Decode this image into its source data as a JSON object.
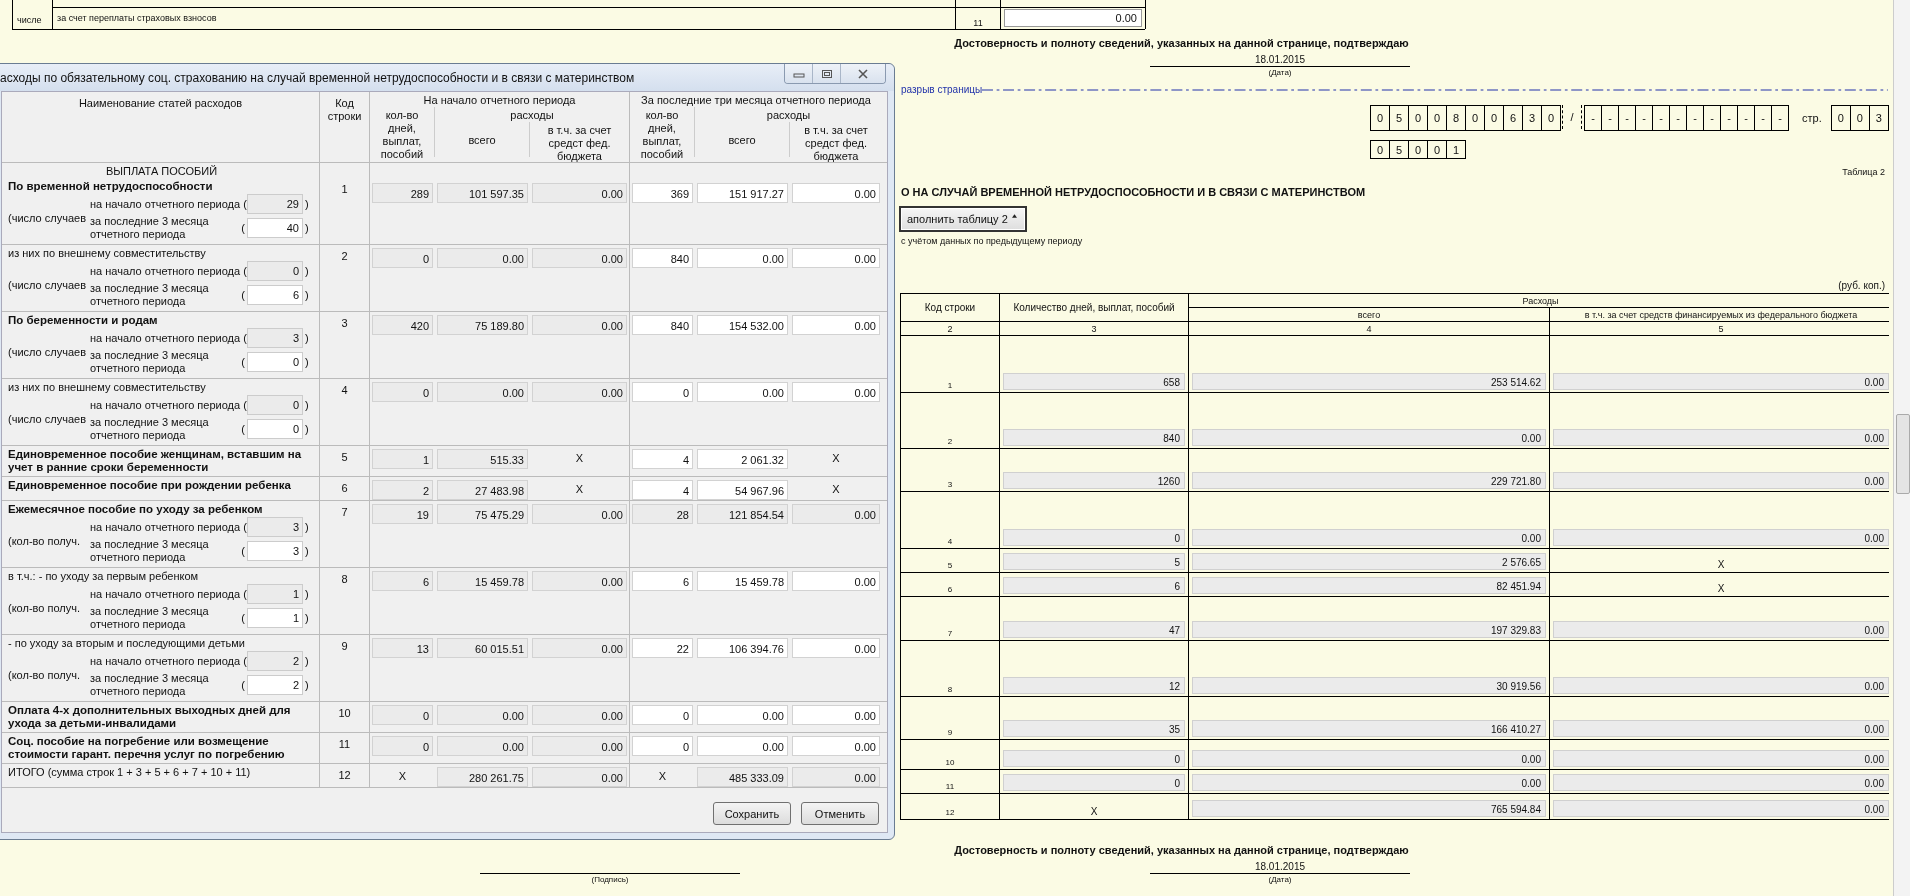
{
  "background": {
    "top_table": {
      "group_label": "числе",
      "row_label": "за счет переплаты страховых взносов",
      "code": "11",
      "value": "0.00"
    },
    "confirm_top": {
      "text": "Достоверность и полноту сведений, указанных на данной странице, подтверждаю",
      "date": "18.01.2015",
      "date_caption": "(Дата)"
    },
    "page_break": "разрыв страницы",
    "codes": {
      "inn": [
        "0",
        "5",
        "0",
        "0",
        "8",
        "0",
        "0",
        "6",
        "3",
        "0"
      ],
      "separator": "/",
      "kpp": [
        "-",
        "-",
        "-",
        "-",
        "-",
        "-",
        "-",
        "-",
        "-",
        "-",
        "-",
        "-"
      ],
      "page_label": "стр.",
      "page": [
        "0",
        "0",
        "3"
      ],
      "sub_code": [
        "0",
        "5",
        "0",
        "0",
        "1"
      ]
    },
    "table_label": "Таблица 2",
    "title": "О НА СЛУЧАЙ ВРЕМЕННОЙ НЕТРУДОСПОСОБНОСТИ И В СВЯЗИ С МАТЕРИНСТВОМ",
    "fill_button": "аполнить таблицу 2",
    "fill_note": "с учётом данных по предыдущему периоду",
    "units": "(руб. коп.)",
    "table": {
      "header": {
        "code": "Код строки",
        "days": "Количество дней, выплат, пособий",
        "expenses": "Расходы",
        "total": "всего",
        "federal": "в т.ч. за счет средств финансируемых из федерального бюджета"
      },
      "numbers": [
        "2",
        "3",
        "4",
        "5"
      ],
      "rows": [
        {
          "code": "1",
          "cells": [
            {
              "kind": "field",
              "value": "658"
            },
            {
              "kind": "field",
              "value": "253 514.62"
            },
            {
              "kind": "field",
              "value": "0.00"
            }
          ]
        },
        {
          "code": "2",
          "cells": [
            {
              "kind": "field",
              "value": "840"
            },
            {
              "kind": "field",
              "value": "0.00"
            },
            {
              "kind": "field",
              "value": "0.00"
            }
          ]
        },
        {
          "code": "3",
          "cells": [
            {
              "kind": "field",
              "value": "1260"
            },
            {
              "kind": "field",
              "value": "229 721.80"
            },
            {
              "kind": "field",
              "value": "0.00"
            }
          ]
        },
        {
          "code": "4",
          "cells": [
            {
              "kind": "field",
              "value": "0"
            },
            {
              "kind": "field",
              "value": "0.00"
            },
            {
              "kind": "field",
              "value": "0.00"
            }
          ]
        },
        {
          "code": "5",
          "cells": [
            {
              "kind": "field",
              "value": "5"
            },
            {
              "kind": "field",
              "value": "2 576.65"
            },
            {
              "kind": "mark",
              "value": "X"
            }
          ]
        },
        {
          "code": "6",
          "cells": [
            {
              "kind": "field",
              "value": "6"
            },
            {
              "kind": "field",
              "value": "82 451.94"
            },
            {
              "kind": "mark",
              "value": "X"
            }
          ]
        },
        {
          "code": "7",
          "cells": [
            {
              "kind": "field",
              "value": "47"
            },
            {
              "kind": "field",
              "value": "197 329.83"
            },
            {
              "kind": "field",
              "value": "0.00"
            }
          ]
        },
        {
          "code": "8",
          "cells": [
            {
              "kind": "field",
              "value": "12"
            },
            {
              "kind": "field",
              "value": "30 919.56"
            },
            {
              "kind": "field",
              "value": "0.00"
            }
          ]
        },
        {
          "code": "9",
          "cells": [
            {
              "kind": "field",
              "value": "35"
            },
            {
              "kind": "field",
              "value": "166 410.27"
            },
            {
              "kind": "field",
              "value": "0.00"
            }
          ]
        },
        {
          "code": "10",
          "cells": [
            {
              "kind": "field",
              "value": "0"
            },
            {
              "kind": "field",
              "value": "0.00"
            },
            {
              "kind": "field",
              "value": "0.00"
            }
          ]
        },
        {
          "code": "11",
          "cells": [
            {
              "kind": "field",
              "value": "0"
            },
            {
              "kind": "field",
              "value": "0.00"
            },
            {
              "kind": "field",
              "value": "0.00"
            }
          ]
        },
        {
          "code": "12",
          "cells": [
            {
              "kind": "mark",
              "value": "X"
            },
            {
              "kind": "field",
              "value": "765 594.84"
            },
            {
              "kind": "field",
              "value": "0.00"
            }
          ]
        }
      ]
    },
    "confirm_bottom": {
      "text": "Достоверность и полноту сведений, указанных на данной странице, подтверждаю",
      "signature_caption": "(Подпись)",
      "date": "18.01.2015",
      "date_caption": "(Дата)"
    }
  },
  "dialog": {
    "title": "асходы по обязательному соц. страхованию на случай временной нетрудоспособности и в связи с материнством",
    "header": {
      "name": "Наименование статей расходов",
      "code": "Код строки",
      "groups": [
        {
          "title": "На начало отчетного периода",
          "days": "кол-во дней, выплат, пособий",
          "expenses": "расходы",
          "total": "всего",
          "federal": "в т.ч. за счет средст фед. бюджета"
        },
        {
          "title": "За последние три месяца отчетного периода",
          "days": "кол-во дней, выплат, пособий",
          "expenses": "расходы",
          "total": "всего",
          "federal": "в т.ч. за счет средст фед. бюджета"
        }
      ]
    },
    "rows": [
      {
        "heading": "ВЫПЛАТА ПОСОБИЙ",
        "title": "По временной нетрудоспособности",
        "bold": true,
        "counts": {
          "label": "(число случаев",
          "start_label": "на начало отчетного периода (",
          "start_value": "29",
          "start_close": ")",
          "last_label": "за последние 3 месяца отчетного периода",
          "last_open": "(",
          "last_value": "40",
          "last_close": ")"
        },
        "code": "1",
        "start": {
          "editable": false,
          "cells": [
            {
              "kind": "field",
              "value": "289"
            },
            {
              "kind": "field",
              "value": "101 597.35"
            },
            {
              "kind": "field",
              "value": "0.00"
            }
          ]
        },
        "last": {
          "editable": true,
          "cells": [
            {
              "kind": "field",
              "value": "369"
            },
            {
              "kind": "field",
              "value": "151 917.27"
            },
            {
              "kind": "field",
              "value": "0.00"
            }
          ]
        }
      },
      {
        "title": "из них по внешнему совместительству",
        "bold": false,
        "counts": {
          "label": "(число случаев",
          "start_label": "на начало отчетного периода (",
          "start_value": "0",
          "start_close": ")",
          "last_label": "за последние 3 месяца отчетного периода",
          "last_open": "(",
          "last_value": "6",
          "last_close": ")"
        },
        "code": "2",
        "start": {
          "editable": false,
          "cells": [
            {
              "kind": "field",
              "value": "0"
            },
            {
              "kind": "field",
              "value": "0.00"
            },
            {
              "kind": "field",
              "value": "0.00"
            }
          ]
        },
        "last": {
          "editable": true,
          "cells": [
            {
              "kind": "field",
              "value": "840"
            },
            {
              "kind": "field",
              "value": "0.00"
            },
            {
              "kind": "field",
              "value": "0.00"
            }
          ]
        }
      },
      {
        "title": "По беременности и родам",
        "bold": true,
        "counts": {
          "label": "(число случаев",
          "start_label": "на начало отчетного периода (",
          "start_value": "3",
          "start_close": ")",
          "last_label": "за последние 3 месяца отчетного периода",
          "last_open": "(",
          "last_value": "0",
          "last_close": ")"
        },
        "code": "3",
        "start": {
          "editable": false,
          "cells": [
            {
              "kind": "field",
              "value": "420"
            },
            {
              "kind": "field",
              "value": "75 189.80"
            },
            {
              "kind": "field",
              "value": "0.00"
            }
          ]
        },
        "last": {
          "editable": true,
          "cells": [
            {
              "kind": "field",
              "value": "840"
            },
            {
              "kind": "field",
              "value": "154 532.00"
            },
            {
              "kind": "field",
              "value": "0.00"
            }
          ]
        }
      },
      {
        "title": "из них по внешнему совместительству",
        "bold": false,
        "counts": {
          "label": "(число случаев",
          "start_label": "на начало отчетного периода (",
          "start_value": "0",
          "start_close": ")",
          "last_label": "за последние 3 месяца отчетного периода",
          "last_open": "(",
          "last_value": "0",
          "last_close": ")"
        },
        "code": "4",
        "start": {
          "editable": false,
          "cells": [
            {
              "kind": "field",
              "value": "0"
            },
            {
              "kind": "field",
              "value": "0.00"
            },
            {
              "kind": "field",
              "value": "0.00"
            }
          ]
        },
        "last": {
          "editable": true,
          "cells": [
            {
              "kind": "field",
              "value": "0"
            },
            {
              "kind": "field",
              "value": "0.00"
            },
            {
              "kind": "field",
              "value": "0.00"
            }
          ]
        }
      },
      {
        "title": "Единовременное пособие женщинам, вставшим на учет в ранние сроки беременности",
        "bold": true,
        "code": "5",
        "start": {
          "editable": false,
          "cells": [
            {
              "kind": "field",
              "value": "1"
            },
            {
              "kind": "field",
              "value": "515.33"
            },
            {
              "kind": "mark",
              "value": "X"
            }
          ]
        },
        "last": {
          "editable": true,
          "cells": [
            {
              "kind": "field",
              "value": "4"
            },
            {
              "kind": "field",
              "value": "2 061.32"
            },
            {
              "kind": "mark",
              "value": "X"
            }
          ]
        }
      },
      {
        "title": "Единовременное пособие при рождении ребенка",
        "bold": true,
        "code": "6",
        "start": {
          "editable": false,
          "cells": [
            {
              "kind": "field",
              "value": "2"
            },
            {
              "kind": "field",
              "value": "27 483.98"
            },
            {
              "kind": "mark",
              "value": "X"
            }
          ]
        },
        "last": {
          "editable": true,
          "cells": [
            {
              "kind": "field",
              "value": "4"
            },
            {
              "kind": "field",
              "value": "54 967.96"
            },
            {
              "kind": "mark",
              "value": "X"
            }
          ]
        }
      },
      {
        "title": "Ежемесячное пособие по уходу за ребенком",
        "bold": true,
        "counts": {
          "label": "(кол-во получ.",
          "start_label": "на начало отчетного периода (",
          "start_value": "3",
          "start_close": ")",
          "last_label": "за последние 3 месяца отчетного периода",
          "last_open": "(",
          "last_value": "3",
          "last_close": ")"
        },
        "code": "7",
        "start": {
          "editable": false,
          "cells": [
            {
              "kind": "field",
              "value": "19"
            },
            {
              "kind": "field",
              "value": "75 475.29"
            },
            {
              "kind": "field",
              "value": "0.00"
            }
          ]
        },
        "last": {
          "editable": false,
          "cells": [
            {
              "kind": "field",
              "value": "28"
            },
            {
              "kind": "field",
              "value": "121 854.54"
            },
            {
              "kind": "field",
              "value": "0.00"
            }
          ]
        }
      },
      {
        "title": "в т.ч.: - по уходу за первым ребенком",
        "bold": false,
        "counts": {
          "label": "(кол-во получ.",
          "start_label": "на начало отчетного периода (",
          "start_value": "1",
          "start_close": ")",
          "last_label": "за последние 3 месяца отчетного периода",
          "last_open": "(",
          "last_value": "1",
          "last_close": ")"
        },
        "code": "8",
        "start": {
          "editable": false,
          "cells": [
            {
              "kind": "field",
              "value": "6"
            },
            {
              "kind": "field",
              "value": "15 459.78"
            },
            {
              "kind": "field",
              "value": "0.00"
            }
          ]
        },
        "last": {
          "editable": true,
          "cells": [
            {
              "kind": "field",
              "value": "6"
            },
            {
              "kind": "field",
              "value": "15 459.78"
            },
            {
              "kind": "field",
              "value": "0.00"
            }
          ]
        }
      },
      {
        "title": "- по уходу за вторым и последующими детьми",
        "bold": false,
        "counts": {
          "label": "(кол-во получ.",
          "start_label": "на начало отчетного периода (",
          "start_value": "2",
          "start_close": ")",
          "last_label": "за последние 3 месяца отчетного периода",
          "last_open": "(",
          "last_value": "2",
          "last_close": ")"
        },
        "code": "9",
        "start": {
          "editable": false,
          "cells": [
            {
              "kind": "field",
              "value": "13"
            },
            {
              "kind": "field",
              "value": "60 015.51"
            },
            {
              "kind": "field",
              "value": "0.00"
            }
          ]
        },
        "last": {
          "editable": true,
          "cells": [
            {
              "kind": "field",
              "value": "22"
            },
            {
              "kind": "field",
              "value": "106 394.76"
            },
            {
              "kind": "field",
              "value": "0.00"
            }
          ]
        }
      },
      {
        "title": "Оплата 4-х дополнительных выходных дней для ухода за детьми-инвалидами",
        "bold": true,
        "code": "10",
        "start": {
          "editable": false,
          "cells": [
            {
              "kind": "field",
              "value": "0"
            },
            {
              "kind": "field",
              "value": "0.00"
            },
            {
              "kind": "field",
              "value": "0.00"
            }
          ]
        },
        "last": {
          "editable": true,
          "cells": [
            {
              "kind": "field",
              "value": "0"
            },
            {
              "kind": "field",
              "value": "0.00"
            },
            {
              "kind": "field",
              "value": "0.00"
            }
          ]
        }
      },
      {
        "title": "Соц. пособие на погребение или возмещение стоимости гарант. перечня услуг по погребению",
        "bold": true,
        "code": "11",
        "start": {
          "editable": false,
          "cells": [
            {
              "kind": "field",
              "value": "0"
            },
            {
              "kind": "field",
              "value": "0.00"
            },
            {
              "kind": "field",
              "value": "0.00"
            }
          ]
        },
        "last": {
          "editable": true,
          "cells": [
            {
              "kind": "field",
              "value": "0"
            },
            {
              "kind": "field",
              "value": "0.00"
            },
            {
              "kind": "field",
              "value": "0.00"
            }
          ]
        }
      },
      {
        "title": "ИТОГО (сумма строк 1 + 3 + 5 + 6 + 7 + 10 + 11)",
        "bold": false,
        "code": "12",
        "start": {
          "editable": false,
          "cells": [
            {
              "kind": "mark",
              "value": "X"
            },
            {
              "kind": "field",
              "value": "280 261.75"
            },
            {
              "kind": "field",
              "value": "0.00"
            }
          ]
        },
        "last": {
          "editable": false,
          "cells": [
            {
              "kind": "mark",
              "value": "X"
            },
            {
              "kind": "field",
              "value": "485 333.09"
            },
            {
              "kind": "field",
              "value": "0.00"
            }
          ]
        }
      }
    ],
    "buttons": [
      "Сохранить",
      "Отменить"
    ]
  }
}
